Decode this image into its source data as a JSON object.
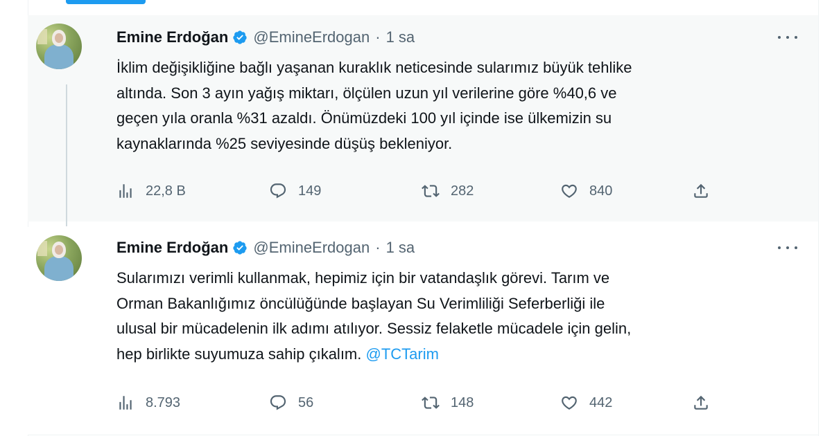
{
  "tweets": [
    {
      "author": {
        "name": "Emine Erdoğan",
        "handle": "@EmineErdogan",
        "verified": true
      },
      "separator": "·",
      "time": "1 sa",
      "lines": [
        "İklim değişikliğine bağlı yaşanan kuraklık neticesinde sularımız büyük tehlike",
        "altında. Son 3 ayın yağış miktarı, ölçülen uzun yıl verilerine göre %40,6 ve",
        "geçen yıla oranla %31 azaldı. Önümüzdeki 100 yıl içinde ise ülkemizin su",
        "kaynaklarında %25 seviyesinde düşüş bekleniyor."
      ],
      "stats": {
        "views": "22,8 B",
        "replies": "149",
        "retweets": "282",
        "likes": "840"
      }
    },
    {
      "author": {
        "name": "Emine Erdoğan",
        "handle": "@EmineErdogan",
        "verified": true
      },
      "separator": "·",
      "time": "1 sa",
      "lines": [
        "Sularımızı verimli kullanmak, hepimiz için bir vatandaşlık görevi. Tarım ve",
        "Orman Bakanlığımız öncülüğünde başlayan Su Verimliliği Seferberliği ile",
        "ulusal bir mücadelenin ilk adımı atılıyor. Sessiz felaketle mücadele için gelin,"
      ],
      "last_line_text": "hep birlikte suyumuza sahip çıkalım.",
      "mention": "@TCTarim",
      "stats": {
        "views": "8.793",
        "replies": "56",
        "retweets": "148",
        "likes": "442"
      }
    }
  ],
  "icons": {
    "verified": "verified-badge-icon",
    "more": "more-options-icon",
    "views": "views-icon",
    "reply": "reply-icon",
    "retweet": "retweet-icon",
    "like": "like-icon",
    "share": "share-icon"
  },
  "colors": {
    "accent": "#1d9bf0",
    "text": "#0f1419",
    "muted": "#536471",
    "background": "#ffffff"
  }
}
